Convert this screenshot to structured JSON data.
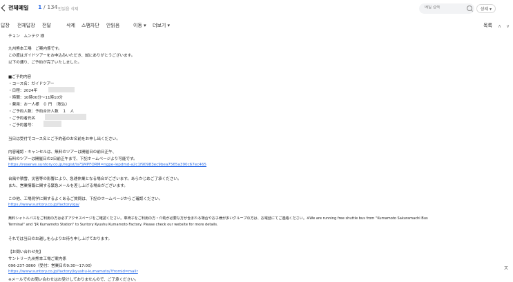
{
  "header": {
    "folder_title": "전체메일",
    "count_current": "1",
    "count_total": "/ 134",
    "unread_delete": "안읽음 삭제",
    "search_placeholder": "메일 검색",
    "detail_label": "상세 ▾"
  },
  "toolbar": {
    "items": [
      "답장",
      "전체답장",
      "전달",
      "삭제",
      "스팸차단",
      "안읽음",
      "이동 ▾",
      "더보기 ▾"
    ],
    "list_label": "목록",
    "prev": "∧",
    "next": "∨"
  },
  "mail": {
    "lines": [
      "チョン　ムンテク 様",
      "九州熊本工場　ご案内係です。",
      "この度はガイドツアーをお申込みいただき、誠にありがとうございます。",
      "以下の通り、ご予約が完了いたしました。",
      "■ご予約内容",
      "・コース名：ガイドツアー",
      "・日程：2024年",
      "・時間：10時00分～11時10分",
      "・費用：お一人様　０ 円　（税込）",
      "・ご予約人数：予約合計人数　１　人",
      "・ご予約者氏名",
      "・ご予約番号：",
      "当日は受付でコース名とご予約者のお名前をお申し出ください。",
      "内容確認・キャンセルは、無料のツアーは開催日の前日正午、",
      "有料のツアーは開催日の2日前正午まで、下記ホームページより可能です。",
      "https://reserve.suntory.co.jp/regist/is?SMPFORM=ngpe-lepdmd-a2c1f90983ec9bea7565a390c67ec465",
      "台風や積雪、災害等の影響により、急遽休業となる場合がございます。あらかじめご了承ください。",
      "また、営業情報に関する緊急メールを差し上げる場合がございます。",
      "この他、工場見学に関するよくあるご質問は、下記のホームページからご確認ください。",
      "https://www.suntory.co.jp/factory/qa/",
      "無料シャトルバスをご利用の方は必ずアクセスページをご確認ください。車椅子をご利用の方・介助が必要な方が含まれる場合やお子様が多いグループの方は、お電話にてご連絡ください。※We are running free shuttle bus from \"Kumamoto Sakuramachi Bus",
      "Terminal\" and \"JR Kumamoto Station\" to Suntory Kyushu Kumamoto Factory. Please check our website for more details.",
      "それでは当日のお越しを心よりお待ち申し上げております。",
      "【お問い合わせ先】",
      "サントリー九州熊本工場ご案内係",
      "096-237-3860（受付：営業日の9:30～17:00）",
      "https://www.suntory.co.jp/factory/kyushu-kumamoto/?fromid=mailr",
      "※メールでのお問い合わせはお受けしておりませんので、ご了承ください。"
    ]
  },
  "scroll_top_label": "ㅈ"
}
